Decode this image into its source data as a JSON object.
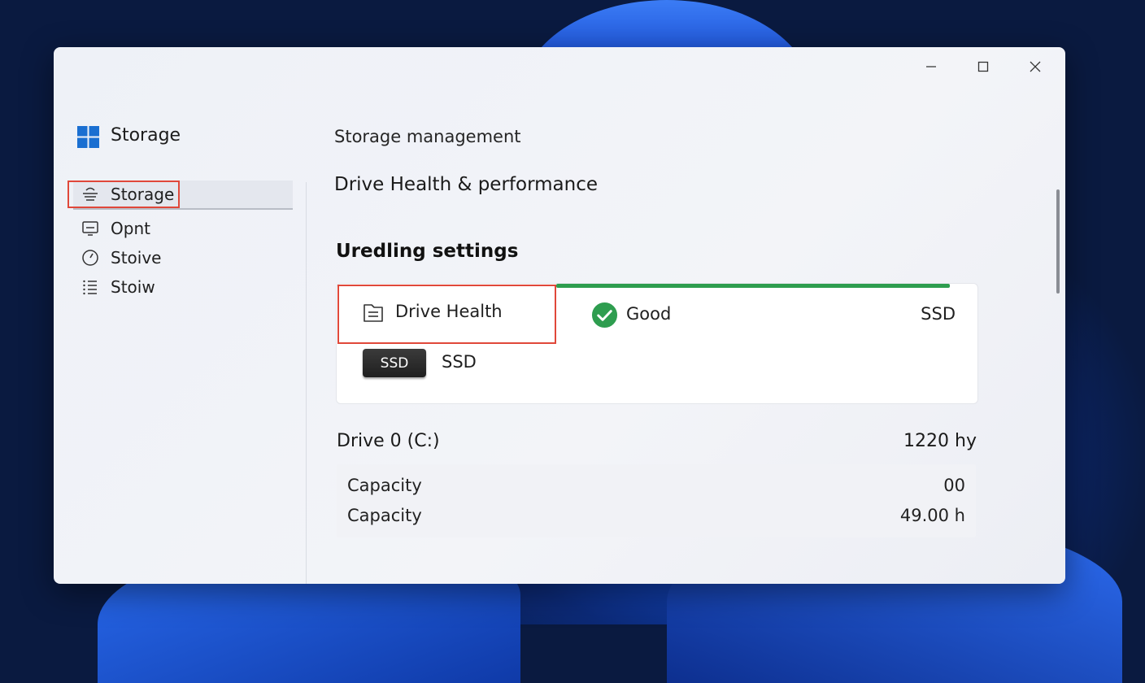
{
  "app": {
    "title": "Storage"
  },
  "window_controls": {
    "minimize": "minimize-icon",
    "maximize": "maximize-icon",
    "close": "close-icon"
  },
  "sidebar": {
    "items": [
      {
        "label": "Storage",
        "icon": "storage-icon",
        "active": true
      },
      {
        "label": "Opnt",
        "icon": "monitor-icon"
      },
      {
        "label": "Stoive",
        "icon": "gauge-icon"
      },
      {
        "label": "Stoiw",
        "icon": "list-icon"
      }
    ]
  },
  "main": {
    "breadcrumb": "Storage management",
    "page_title": "Drive Health & performance",
    "section_title": "Uredling settings",
    "health_card": {
      "label": "Drive Health",
      "status": "Good",
      "type_right": "SSD",
      "badge": "SSD",
      "badge_text": "SSD",
      "status_color": "#2e9d4f"
    },
    "drive": {
      "name": "Drive 0 (C:)",
      "size": "1220 hy",
      "rows": [
        {
          "label": "Capacity",
          "value": "00"
        },
        {
          "label": "Capacity",
          "value": "49.00 h"
        }
      ]
    }
  }
}
